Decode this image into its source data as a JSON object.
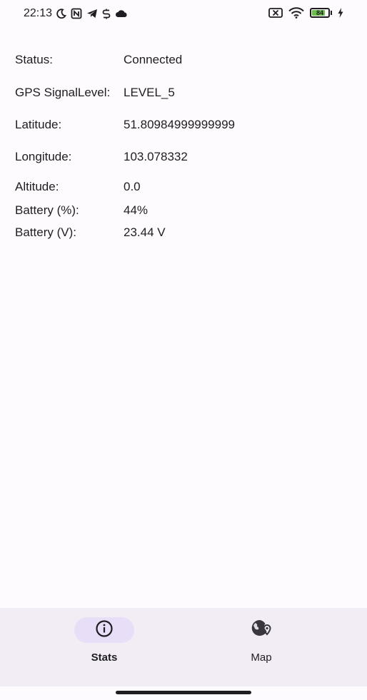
{
  "status_bar": {
    "time": "22:13",
    "battery_level": "84",
    "battery_fraction": 0.84,
    "icons_left": [
      "moon-icon",
      "nfc-icon",
      "telegram-icon",
      "sync-icon",
      "cloud-icon"
    ],
    "icons_right": [
      "sim-off-icon",
      "wifi-icon",
      "battery-icon",
      "charging-icon"
    ]
  },
  "info": {
    "rows": [
      {
        "label": "Status:",
        "value": "Connected"
      },
      {
        "label": "GPS SignalLevel:",
        "value": "LEVEL_5"
      },
      {
        "label": "Latitude:",
        "value": "51.80984999999999"
      },
      {
        "label": "Longitude:",
        "value": "103.078332"
      },
      {
        "label": "Altitude:",
        "value": "0.0"
      },
      {
        "label": "Battery (%):",
        "value": "44%"
      },
      {
        "label": "Battery (V):",
        "value": "23.44 V"
      }
    ]
  },
  "bottom_nav": {
    "items": [
      {
        "label": "Stats",
        "icon": "info-icon",
        "active": true
      },
      {
        "label": "Map",
        "icon": "globe-pin-icon",
        "active": false
      }
    ]
  },
  "colors": {
    "background": "#fefbfe",
    "nav_background": "#f2ecf5",
    "active_pill": "#e8def7",
    "text": "#1f1d22",
    "battery_green": "#6cc04a"
  }
}
